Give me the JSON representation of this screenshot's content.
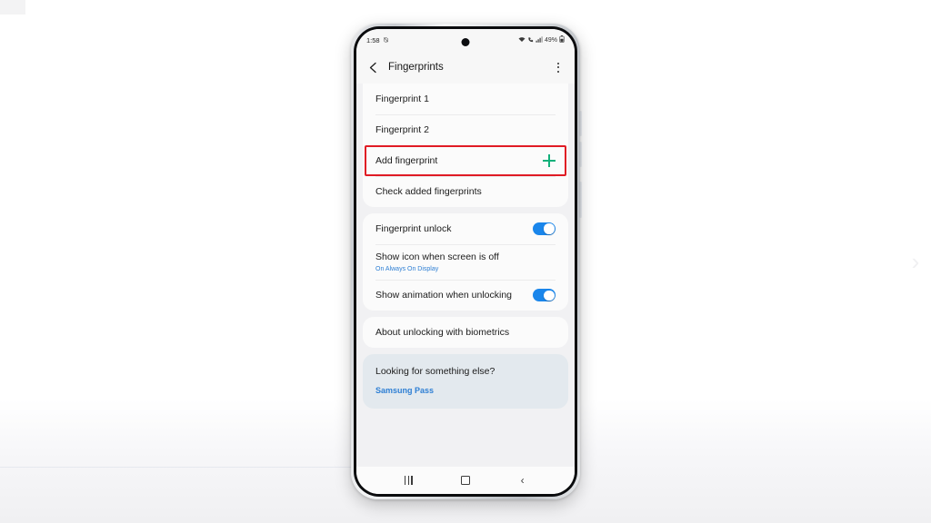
{
  "background": {
    "next_arrow_icon": "chevron-right-icon"
  },
  "device": {
    "frame_color": "#d9dcdf",
    "buttons": {
      "volume_up": "volume-up-button",
      "volume_down": "volume-down-button",
      "power": "power-button"
    }
  },
  "status_bar": {
    "time": "1:58",
    "alarm_icon": "alarm-off-icon",
    "wifi_icon": "wifi-icon",
    "call_icon": "call-status-icon",
    "signal_icon": "cellular-signal-icon",
    "battery_percent": "49%",
    "battery_icon": "battery-icon",
    "camera_icon": "front-camera-punch-hole"
  },
  "app_bar": {
    "back_icon": "back-arrow-icon",
    "title": "Fingerprints",
    "overflow_icon": "more-options-icon"
  },
  "fingerprint_list": [
    {
      "label": "Fingerprint 1",
      "trailing": "none"
    },
    {
      "label": "Fingerprint 2",
      "trailing": "none"
    },
    {
      "label": "Add fingerprint",
      "trailing": "plus-icon",
      "highlighted": true
    },
    {
      "label": "Check added fingerprints",
      "trailing": "none"
    }
  ],
  "settings_group": [
    {
      "label": "Fingerprint unlock",
      "sublabel": "",
      "toggle": true,
      "toggle_on": true
    },
    {
      "label": "Show icon when screen is off",
      "sublabel": "On Always On Display",
      "toggle": false,
      "toggle_on": false
    },
    {
      "label": "Show animation when unlocking",
      "sublabel": "",
      "toggle": true,
      "toggle_on": true
    }
  ],
  "about_group": [
    {
      "label": "About unlocking with biometrics"
    }
  ],
  "promo": {
    "title": "Looking for something else?",
    "link": "Samsung Pass"
  },
  "nav_bar": {
    "recents": "recents-button",
    "home": "home-button",
    "back": "back-button"
  },
  "colors": {
    "accent_blue": "#2e7fd4",
    "toggle_on": "#1a86eb",
    "plus_green": "#12b07a",
    "highlight_red": "#e01b24",
    "promo_bg": "#e3e9ee"
  }
}
